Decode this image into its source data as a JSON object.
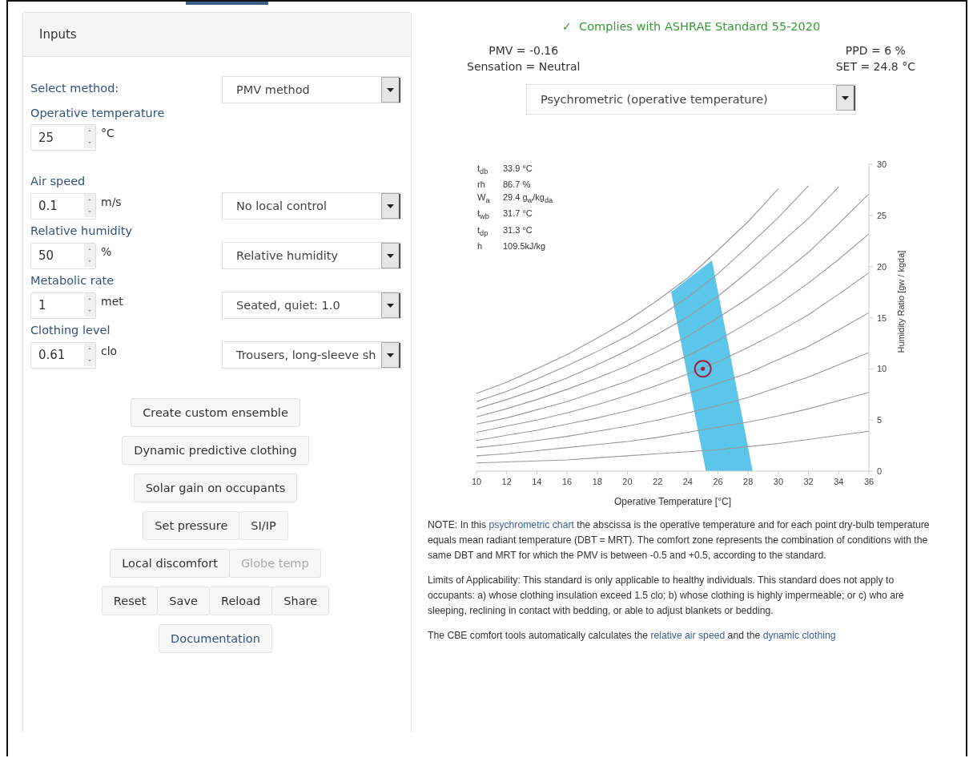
{
  "inputs_panel": {
    "title": "Inputs",
    "method": {
      "label": "Select method:",
      "value": "PMV method"
    },
    "fields": [
      {
        "label": "Operative temperature",
        "value": "25",
        "unit": "°C"
      },
      {
        "label": "Air speed",
        "value": "0.1",
        "unit": "m/s",
        "option": "No local control"
      },
      {
        "label": "Relative humidity",
        "value": "50",
        "unit": "%",
        "option": "Relative humidity"
      },
      {
        "label": "Metabolic rate",
        "value": "1",
        "unit": "met",
        "option": "Seated, quiet: 1.0"
      },
      {
        "label": "Clothing level",
        "value": "0.61",
        "unit": "clo",
        "option": "Trousers, long-sleeve sh"
      }
    ],
    "button_rows": [
      [
        {
          "label": "Create custom ensemble",
          "kind": "plain",
          "disabled": false
        }
      ],
      [
        {
          "label": "Dynamic predictive clothing",
          "kind": "plain",
          "disabled": false
        }
      ],
      [
        {
          "label": "Solar gain on occupants",
          "kind": "plain",
          "disabled": false
        }
      ],
      [
        {
          "label": "Set pressure",
          "kind": "plain",
          "disabled": false
        },
        {
          "label": "SI/IP",
          "kind": "plain",
          "disabled": false
        }
      ],
      [
        {
          "label": "Local discomfort",
          "kind": "plain",
          "disabled": false
        },
        {
          "label": "Globe temp",
          "kind": "plain",
          "disabled": true
        }
      ],
      [
        {
          "label": "Reset",
          "kind": "plain",
          "disabled": false
        },
        {
          "label": "Save",
          "kind": "plain",
          "disabled": false
        },
        {
          "label": "Reload",
          "kind": "plain",
          "disabled": false
        },
        {
          "label": "Share",
          "kind": "plain",
          "disabled": false
        }
      ],
      [
        {
          "label": "Documentation",
          "kind": "link",
          "disabled": false
        }
      ]
    ]
  },
  "results": {
    "status": {
      "icon": "✓",
      "text": "Complies with ASHRAE Standard 55-2020",
      "compliant": true
    },
    "metrics_left": [
      "PMV = -0.16",
      "Sensation = Neutral"
    ],
    "metrics_right": [
      "PPD = 6 %",
      "SET = 24.8 °C"
    ],
    "chart_type": "Psychrometric (operative temperature)",
    "readout": [
      {
        "label": "t$_{db}$",
        "value": "33.9 °C"
      },
      {
        "label": "rh",
        "value": "86.7 %"
      },
      {
        "label": "W$_{a}$",
        "value": "29.4 g$_{w}$/kg$_{da}$"
      },
      {
        "label": "t$_{wb}$",
        "value": "31.7 °C"
      },
      {
        "label": "t$_{dp}$",
        "value": "31.3 °C"
      },
      {
        "label": "h",
        "value": "109.5kJ/kg"
      }
    ],
    "chart_data": {
      "type": "line",
      "xlabel": "Operative Temperature [°C]",
      "ylabel": "Humidity Ratio [gw / kgda]",
      "x": [
        10,
        12,
        14,
        16,
        18,
        20,
        22,
        24,
        26,
        28,
        30,
        32,
        34,
        36
      ],
      "xlim": [
        10,
        36
      ],
      "ylim": [
        0,
        30
      ],
      "xticks": [
        10,
        12,
        14,
        16,
        18,
        20,
        22,
        24,
        26,
        28,
        30,
        32,
        34,
        36
      ],
      "yticks": [
        0,
        5,
        10,
        15,
        20,
        25,
        30
      ],
      "series": [
        {
          "color": "#999999",
          "values": [
            7.6,
            8.7,
            10.0,
            11.4,
            13.0,
            14.7,
            16.7,
            18.9,
            21.6,
            24.4,
            27.6,
            null,
            null,
            null
          ]
        },
        {
          "color": "#999999",
          "values": [
            6.8,
            7.8,
            9.0,
            10.3,
            11.7,
            13.2,
            15.0,
            17.0,
            19.3,
            22.0,
            24.8,
            27.9,
            null,
            null
          ]
        },
        {
          "color": "#999999",
          "values": [
            6.1,
            7.0,
            8.0,
            9.1,
            10.4,
            11.8,
            13.4,
            15.1,
            17.1,
            19.5,
            22.1,
            24.7,
            27.8,
            null
          ]
        },
        {
          "color": "#999999",
          "values": [
            5.3,
            6.1,
            7.0,
            8.0,
            9.1,
            10.3,
            11.7,
            13.2,
            15.0,
            16.9,
            19.0,
            21.4,
            24.2,
            27.1
          ]
        },
        {
          "color": "#999999",
          "values": [
            4.6,
            5.2,
            6.0,
            6.8,
            7.8,
            8.8,
            10.0,
            11.3,
            12.8,
            14.5,
            16.3,
            18.4,
            20.7,
            23.2
          ]
        },
        {
          "color": "#999999",
          "values": [
            3.8,
            4.4,
            5.0,
            5.7,
            6.5,
            7.4,
            8.4,
            9.5,
            10.7,
            12.1,
            13.6,
            15.3,
            17.3,
            19.4
          ]
        },
        {
          "color": "#999999",
          "values": [
            3.0,
            3.5,
            4.0,
            4.6,
            5.2,
            5.9,
            6.7,
            7.6,
            8.6,
            9.6,
            10.9,
            12.2,
            13.8,
            15.5
          ]
        },
        {
          "color": "#999999",
          "values": [
            2.3,
            2.6,
            3.0,
            3.4,
            3.9,
            4.4,
            5.0,
            5.7,
            6.4,
            7.2,
            8.2,
            9.2,
            10.4,
            11.6
          ]
        },
        {
          "color": "#999999",
          "values": [
            1.5,
            1.7,
            2.0,
            2.3,
            2.6,
            2.9,
            3.3,
            3.8,
            4.3,
            4.8,
            5.4,
            6.1,
            6.9,
            7.7
          ]
        },
        {
          "color": "#999999",
          "values": [
            0.8,
            0.9,
            1.0,
            1.1,
            1.3,
            1.5,
            1.7,
            1.9,
            2.1,
            2.4,
            2.7,
            3.1,
            3.5,
            3.9
          ]
        }
      ]
    },
    "notes": [
      [
        {
          "text": "NOTE: In this "
        },
        {
          "text": "psychrometric chart",
          "link": true
        },
        {
          "text": " the abscissa is the operative temperature and for each point dry-bulb temperature equals mean radiant temperature (DBT = MRT). The comfort zone represents the combination of conditions with the same DBT and MRT for which the PMV is between -0.5 and +0.5, according to the standard."
        }
      ],
      [
        {
          "text": "Limits of Applicability: This standard is only applicable to healthy individuals. This standard does not apply to occupants: a) whose clothing insulation exceed 1.5 clo; b) whose clothing is highly impermeable; or c) who are sleeping, reclining in contact with bedding, or able to adjust blankets or bedding."
        }
      ],
      [
        {
          "text": "The CBE comfort tools automatically calculates the "
        },
        {
          "text": "relative air speed",
          "link": true
        },
        {
          "text": " and the "
        },
        {
          "text": "dynamic clothing",
          "link": true
        }
      ]
    ]
  }
}
